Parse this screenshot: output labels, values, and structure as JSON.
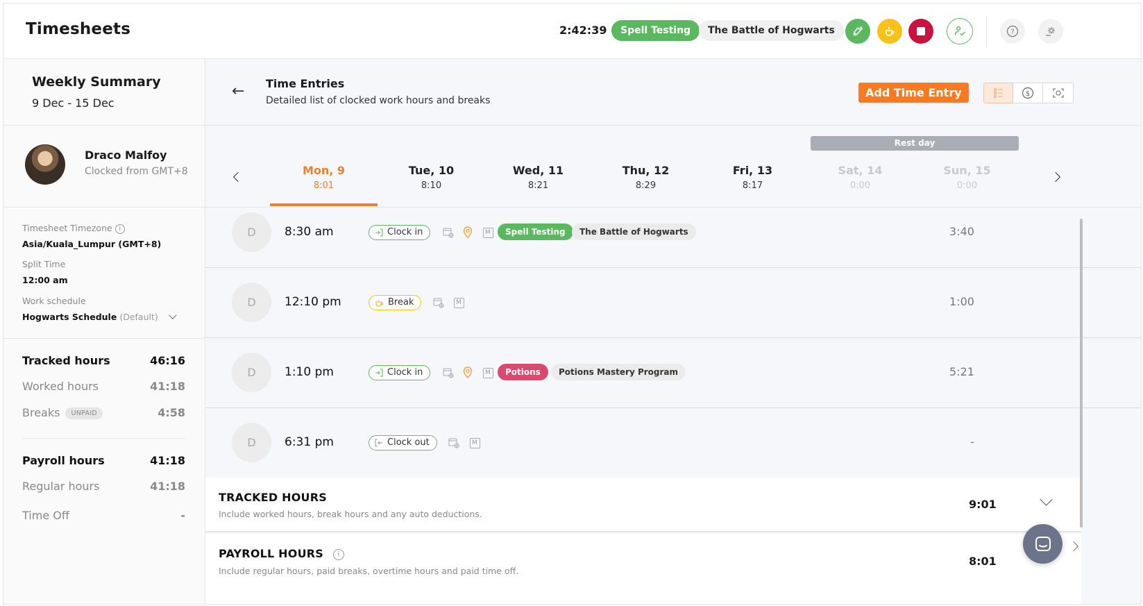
{
  "header": {
    "title": "Timesheets",
    "timer": "2:42:39",
    "current_activity": "Spell Testing",
    "current_project": "The Battle of Hogwarts",
    "actions": [
      {
        "name": "switch-activity",
        "icon": "switch-icon",
        "color": "#5cb860"
      },
      {
        "name": "take-break",
        "icon": "coffee-icon",
        "color": "#f8c21a"
      },
      {
        "name": "clock-out",
        "icon": "stop-icon",
        "color": "#c8123f"
      },
      {
        "name": "team-member",
        "icon": "user-check-icon",
        "color": "#5cb860"
      },
      {
        "name": "help",
        "icon": "help-icon"
      },
      {
        "name": "settings",
        "icon": "settings-icon"
      }
    ]
  },
  "sidebar": {
    "summary_title": "Weekly Summary",
    "date_range": "9 Dec - 15 Dec",
    "user": {
      "name": "Draco Malfoy",
      "subtitle": "Clocked from GMT+8"
    },
    "timezone_label": "Timesheet Timezone",
    "timezone_value": "Asia/Kuala_Lumpur (GMT+8)",
    "split_label": "Split Time",
    "split_value": "12:00 am",
    "schedule_label": "Work schedule",
    "schedule_value": "Hogwarts Schedule",
    "schedule_tag": "(Default)",
    "totals": {
      "tracked": {
        "label": "Tracked hours",
        "value": "46:16"
      },
      "worked": {
        "label": "Worked hours",
        "value": "41:18"
      },
      "breaks": {
        "label": "Breaks",
        "badge": "UNPAID",
        "value": "4:58"
      },
      "payroll": {
        "label": "Payroll hours",
        "value": "41:18"
      },
      "regular": {
        "label": "Regular hours",
        "value": "41:18"
      },
      "timeoff": {
        "label": "Time Off",
        "value": "-"
      }
    }
  },
  "main": {
    "title": "Time Entries",
    "subtitle": "Detailed list of clocked work hours and breaks",
    "add_button": "Add Time Entry",
    "view_modes": [
      "list-view",
      "cost-view",
      "photo-view"
    ],
    "rest_day_label": "Rest day",
    "accent": "#f07d2c",
    "days": [
      {
        "label": "Mon, 9",
        "hours": "8:01",
        "state": "active"
      },
      {
        "label": "Tue, 10",
        "hours": "8:10",
        "state": "normal"
      },
      {
        "label": "Wed, 11",
        "hours": "8:21",
        "state": "normal"
      },
      {
        "label": "Thu, 12",
        "hours": "8:29",
        "state": "normal"
      },
      {
        "label": "Fri, 13",
        "hours": "8:17",
        "state": "normal"
      },
      {
        "label": "Sat, 14",
        "hours": "0:00",
        "state": "rest"
      },
      {
        "label": "Sun, 15",
        "hours": "0:00",
        "state": "rest"
      }
    ],
    "entries": [
      {
        "avatar": "D",
        "time": "8:30 am",
        "type": "Clock in",
        "activity": "Spell Testing",
        "project": "The Battle of Hogwarts",
        "duration": "3:40"
      },
      {
        "avatar": "D",
        "time": "12:10 pm",
        "type": "Break",
        "duration": "1:00"
      },
      {
        "avatar": "D",
        "time": "1:10 pm",
        "type": "Clock in",
        "activity": "Potions",
        "project": "Potions Mastery Program",
        "duration": "5:21"
      },
      {
        "avatar": "D",
        "time": "6:31 pm",
        "type": "Clock out",
        "duration": "-"
      }
    ],
    "tracked_panel": {
      "title": "TRACKED HOURS",
      "subtitle": "Include worked hours, break hours and any auto deductions.",
      "value": "9:01"
    },
    "payroll_panel": {
      "title": "PAYROLL HOURS",
      "subtitle": "Include regular hours, paid breaks, overtime hours and paid time off.",
      "value": "8:01"
    }
  }
}
